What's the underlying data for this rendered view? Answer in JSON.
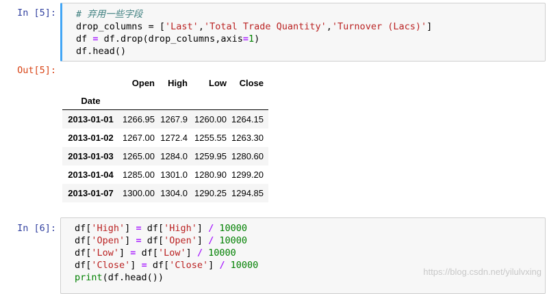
{
  "cell1": {
    "prompt": "In  [5]:",
    "code_comment": "# 弃用一些字段",
    "code_line2_a": "drop_columns = [",
    "code_line2_s1": "'Last'",
    "code_line2_s2": "'Total Trade Quantity'",
    "code_line2_s3": "'Turnover (Lacs)'",
    "code_line3_a": "df ",
    "code_line3_b": "=",
    "code_line3_c": " df.drop(drop_columns,axis",
    "code_line3_d": "=",
    "code_line3_e": "1",
    "code_line3_f": ")",
    "code_line4": "df.head()"
  },
  "output1": {
    "prompt": "Out[5]:",
    "columns": [
      "Open",
      "High",
      "Low",
      "Close"
    ],
    "index_name": "Date",
    "rows": [
      {
        "date": "2013-01-01",
        "open": "1266.95",
        "high": "1267.9",
        "low": "1260.00",
        "close": "1264.15"
      },
      {
        "date": "2013-01-02",
        "open": "1267.00",
        "high": "1272.4",
        "low": "1255.55",
        "close": "1263.30"
      },
      {
        "date": "2013-01-03",
        "open": "1265.00",
        "high": "1284.0",
        "low": "1259.95",
        "close": "1280.60"
      },
      {
        "date": "2013-01-04",
        "open": "1285.00",
        "high": "1301.0",
        "low": "1280.90",
        "close": "1299.20"
      },
      {
        "date": "2013-01-07",
        "open": "1300.00",
        "high": "1304.0",
        "low": "1290.25",
        "close": "1294.85"
      }
    ]
  },
  "cell2": {
    "prompt": "In  [6]:",
    "lines": [
      {
        "a": "df[",
        "s1": "'High'",
        "b": "] ",
        "eq": "=",
        "c": " df[",
        "s2": "'High'",
        "d": "] ",
        "op": "/",
        "n": " 10000"
      },
      {
        "a": "df[",
        "s1": "'Open'",
        "b": "] ",
        "eq": "=",
        "c": " df[",
        "s2": "'Open'",
        "d": "] ",
        "op": "/",
        "n": " 10000"
      },
      {
        "a": "df[",
        "s1": "'Low'",
        "b": "] ",
        "eq": "=",
        "c": " df[",
        "s2": "'Low'",
        "d": "] ",
        "op": "/",
        "n": " 10000"
      },
      {
        "a": "df[",
        "s1": "'Close'",
        "b": "] ",
        "eq": "=",
        "c": " df[",
        "s2": "'Close'",
        "d": "] ",
        "op": "/",
        "n": " 10000"
      }
    ],
    "last_fn": "print",
    "last_rest": "(df.head())"
  },
  "watermark": "https://blog.csdn.net/yilulvxing"
}
